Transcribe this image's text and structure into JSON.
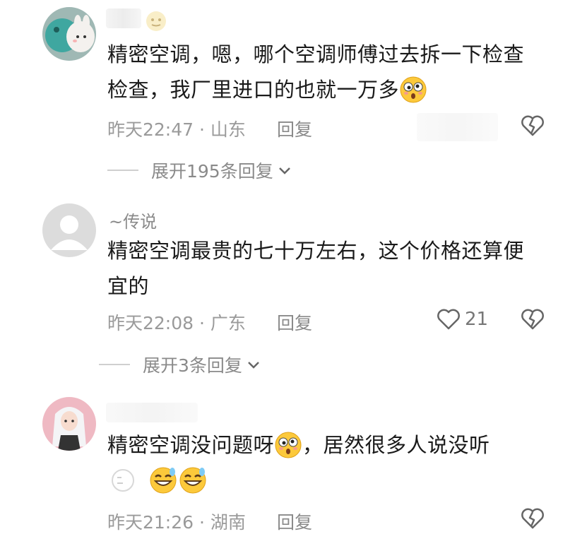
{
  "comments": [
    {
      "username": "",
      "text_line1": "精密空调，嗯，哪个空调师傅过去拆一下检查",
      "text_line2": "检查，我厂里进口的也就一万多",
      "time": "昨天22:47",
      "location": "山东",
      "reply_label": "回复",
      "expand_label": "展开195条回复",
      "avatar_icon": "stuffed-animal-avatar"
    },
    {
      "username": "~传说",
      "text_line1": "精密空调最贵的七十万左右，这个价格还算便",
      "text_line2": "宜的",
      "time": "昨天22:08",
      "location": "广东",
      "reply_label": "回复",
      "like_count": "21",
      "expand_label": "展开3条回复",
      "avatar_icon": "default-user-avatar"
    },
    {
      "username": "",
      "text_line1": "精密空调没问题呀",
      "text_line1b": "，居然很多人说没听",
      "time": "昨天21:26",
      "location": "湖南",
      "reply_label": "回复",
      "avatar_icon": "anime-girl-avatar"
    }
  ],
  "separator": " · ",
  "colors": {
    "text": "#1a1a1a",
    "meta": "#9a9a9a",
    "icon": "#666666"
  }
}
